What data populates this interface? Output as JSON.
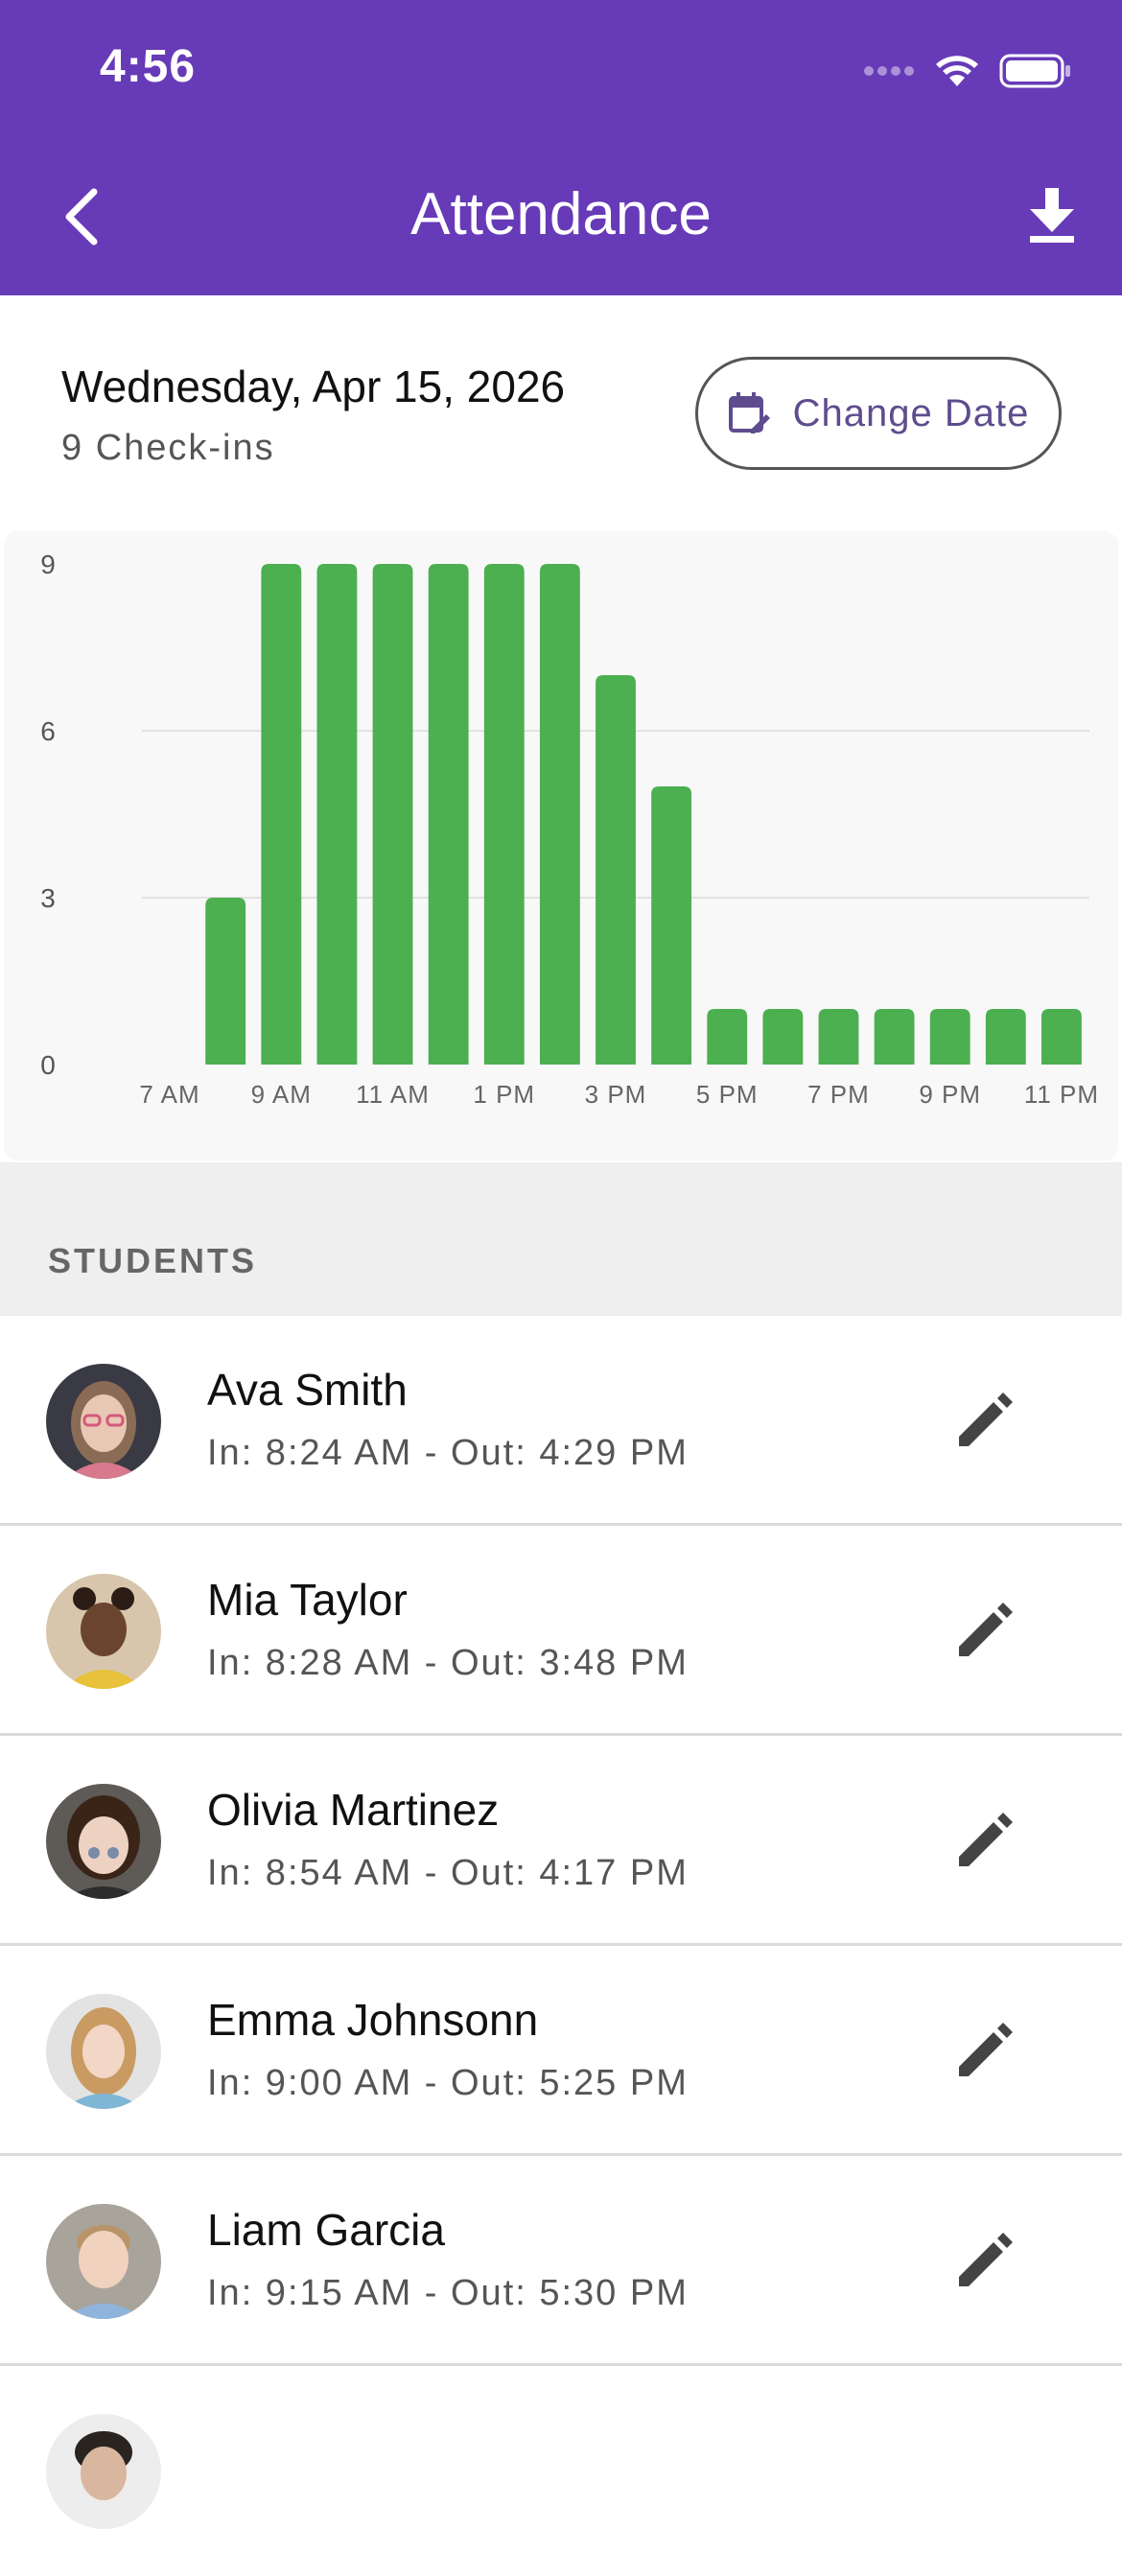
{
  "status_bar": {
    "time": "4:56"
  },
  "header": {
    "title": "Attendance"
  },
  "date_section": {
    "date": "Wednesday, Apr 15, 2026",
    "checkins": "9 Check-ins",
    "change_date_label": "Change Date"
  },
  "chart_data": {
    "type": "bar",
    "categories": [
      "7 AM",
      "8 AM",
      "9 AM",
      "10 AM",
      "11 AM",
      "12 PM",
      "1 PM",
      "2 PM",
      "3 PM",
      "4 PM",
      "5 PM",
      "6 PM",
      "7 PM",
      "8 PM",
      "9 PM",
      "10 PM",
      "11 PM"
    ],
    "x_tick_labels": [
      "7 AM",
      "9 AM",
      "11 AM",
      "1 PM",
      "3 PM",
      "5 PM",
      "7 PM",
      "9 PM",
      "11 PM"
    ],
    "values": [
      0,
      3,
      9,
      9,
      9,
      9,
      9,
      9,
      7,
      5,
      1,
      1,
      1,
      1,
      1,
      1,
      1
    ],
    "y_ticks": [
      0,
      3,
      6,
      9
    ],
    "ylim": [
      0,
      9
    ],
    "grid": true,
    "bar_color": "#4CAF50"
  },
  "students_section": {
    "title": "STUDENTS"
  },
  "students": [
    {
      "name": "Ava Smith",
      "times": "In: 8:24 AM - Out: 4:29 PM"
    },
    {
      "name": "Mia Taylor",
      "times": "In: 8:28 AM - Out: 3:48 PM"
    },
    {
      "name": "Olivia Martinez",
      "times": "In: 8:54 AM - Out: 4:17 PM"
    },
    {
      "name": "Emma Johnsonn",
      "times": "In: 9:00 AM - Out: 5:25 PM"
    },
    {
      "name": "Liam Garcia",
      "times": "In: 9:15 AM - Out: 5:30 PM"
    }
  ],
  "colors": {
    "primary": "#673AB7",
    "bar": "#4CAF50"
  },
  "icons": {
    "back": "chevron-left-icon",
    "download": "download-icon",
    "calendar": "calendar-edit-icon",
    "edit": "pencil-icon"
  }
}
